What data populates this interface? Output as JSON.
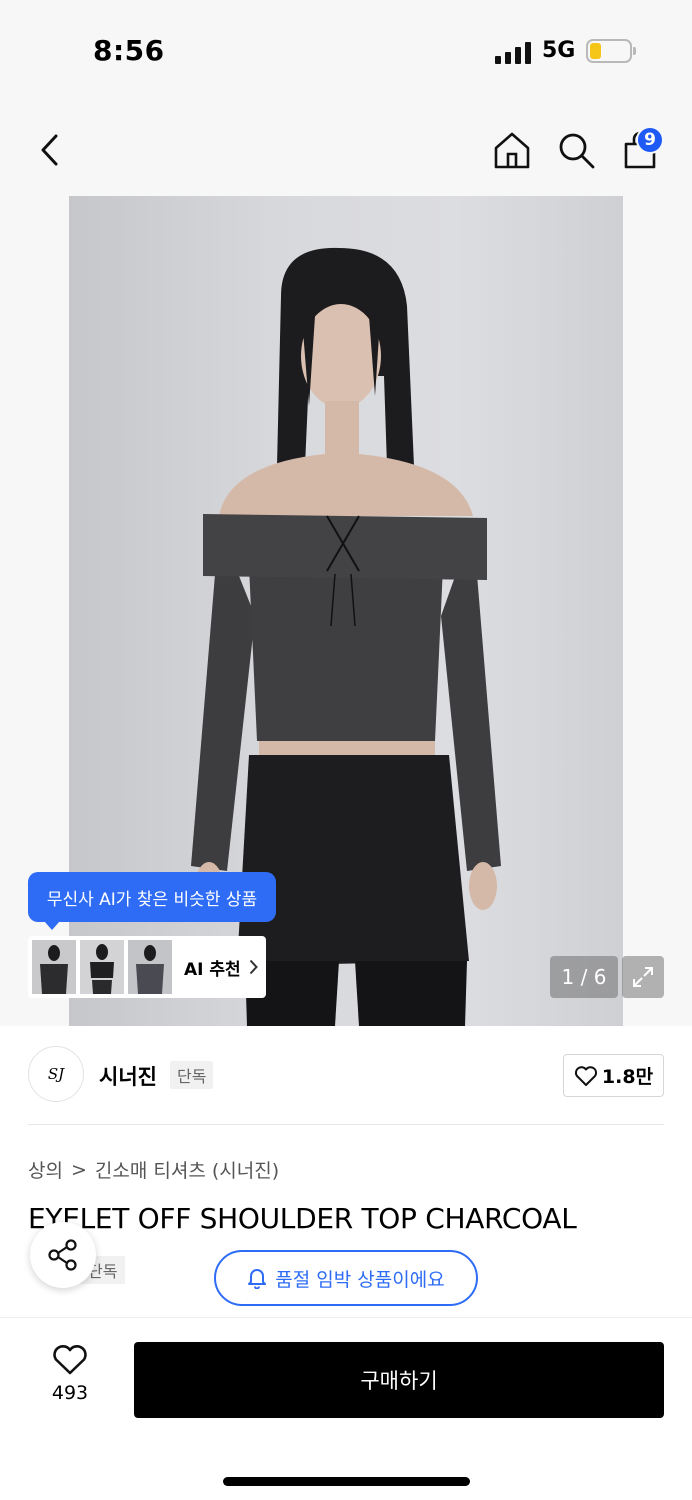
{
  "status_bar": {
    "time": "8:56",
    "network": "5G",
    "battery_color": "#f5c518"
  },
  "header": {
    "cart_count": "9"
  },
  "gallery": {
    "ai_tooltip": "무신사 AI가 찾은 비슷한 상품",
    "ai_recommend_label": "AI 추천",
    "counter": "1 / 6"
  },
  "brand": {
    "logo_text": "SJ",
    "name": "시너진",
    "tag": "단독",
    "likes": "1.8만"
  },
  "breadcrumb": {
    "category": "상의",
    "separator": ">",
    "subcategory": "긴소매 티셔츠 (시너진)"
  },
  "product": {
    "title": "EYELET OFF SHOULDER TOP CHARCOAL",
    "exclusive_tag": "단독"
  },
  "notice": {
    "soldout_pill": "품절 임박 상품이에요"
  },
  "bottom_bar": {
    "like_count": "493",
    "buy_label": "구매하기"
  },
  "colors": {
    "accent": "#2e6cf6",
    "badge": "#1f5af5"
  }
}
